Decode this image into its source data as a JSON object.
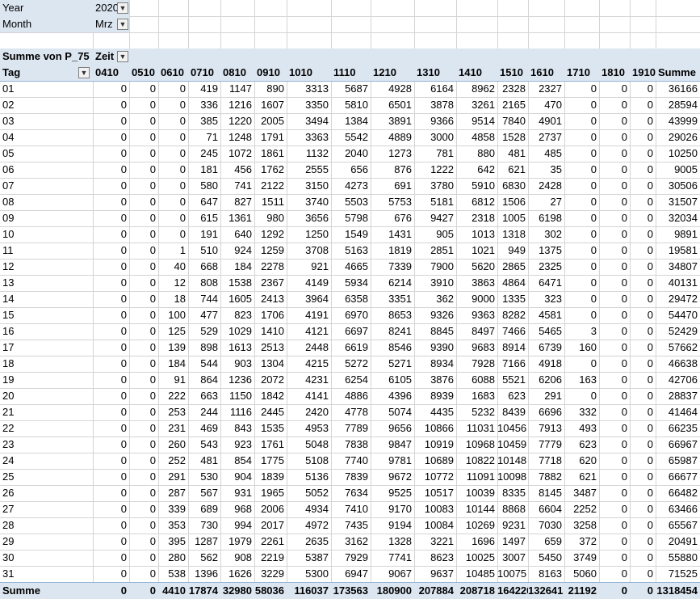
{
  "filters": [
    {
      "label": "Year",
      "value": "2020",
      "icon": "filter-icon"
    },
    {
      "label": "Month",
      "value": "Mrz",
      "icon": "filter-icon"
    }
  ],
  "pivot": {
    "value_label": "Summe von P_75",
    "column_field": "Zeit",
    "row_field": "Tag",
    "column_filter_icon": "filter-icon",
    "row_dropdown_icon": "chevron-down-icon",
    "columns": [
      "0410",
      "0510",
      "0610",
      "0710",
      "0810",
      "0910",
      "1010",
      "1110",
      "1210",
      "1310",
      "1410",
      "1510",
      "1610",
      "1710",
      "1810",
      "1910",
      "Summe"
    ],
    "rows": [
      {
        "tag": "01",
        "values": [
          "0",
          "0",
          "0",
          "419",
          "1147",
          "890",
          "3313",
          "5687",
          "4928",
          "6164",
          "8962",
          "2328",
          "2327",
          "0",
          "0",
          "0",
          "36166"
        ]
      },
      {
        "tag": "02",
        "values": [
          "0",
          "0",
          "0",
          "336",
          "1216",
          "1607",
          "3350",
          "5810",
          "6501",
          "3878",
          "3261",
          "2165",
          "470",
          "0",
          "0",
          "0",
          "28594"
        ]
      },
      {
        "tag": "03",
        "values": [
          "0",
          "0",
          "0",
          "385",
          "1220",
          "2005",
          "3494",
          "1384",
          "3891",
          "9366",
          "9514",
          "7840",
          "4901",
          "0",
          "0",
          "0",
          "43999"
        ]
      },
      {
        "tag": "04",
        "values": [
          "0",
          "0",
          "0",
          "71",
          "1248",
          "1791",
          "3363",
          "5542",
          "4889",
          "3000",
          "4858",
          "1528",
          "2737",
          "0",
          "0",
          "0",
          "29026"
        ]
      },
      {
        "tag": "05",
        "values": [
          "0",
          "0",
          "0",
          "245",
          "1072",
          "1861",
          "1132",
          "2040",
          "1273",
          "781",
          "880",
          "481",
          "485",
          "0",
          "0",
          "0",
          "10250"
        ]
      },
      {
        "tag": "06",
        "values": [
          "0",
          "0",
          "0",
          "181",
          "456",
          "1762",
          "2555",
          "656",
          "876",
          "1222",
          "642",
          "621",
          "35",
          "0",
          "0",
          "0",
          "9005"
        ]
      },
      {
        "tag": "07",
        "values": [
          "0",
          "0",
          "0",
          "580",
          "741",
          "2122",
          "3150",
          "4273",
          "691",
          "3780",
          "5910",
          "6830",
          "2428",
          "0",
          "0",
          "0",
          "30506"
        ]
      },
      {
        "tag": "08",
        "values": [
          "0",
          "0",
          "0",
          "647",
          "827",
          "1511",
          "3740",
          "5503",
          "5753",
          "5181",
          "6812",
          "1506",
          "27",
          "0",
          "0",
          "0",
          "31507"
        ]
      },
      {
        "tag": "09",
        "values": [
          "0",
          "0",
          "0",
          "615",
          "1361",
          "980",
          "3656",
          "5798",
          "676",
          "9427",
          "2318",
          "1005",
          "6198",
          "0",
          "0",
          "0",
          "32034"
        ]
      },
      {
        "tag": "10",
        "values": [
          "0",
          "0",
          "0",
          "191",
          "640",
          "1292",
          "1250",
          "1549",
          "1431",
          "905",
          "1013",
          "1318",
          "302",
          "0",
          "0",
          "0",
          "9891"
        ]
      },
      {
        "tag": "11",
        "values": [
          "0",
          "0",
          "1",
          "510",
          "924",
          "1259",
          "3708",
          "5163",
          "1819",
          "2851",
          "1021",
          "949",
          "1375",
          "0",
          "0",
          "0",
          "19581"
        ]
      },
      {
        "tag": "12",
        "values": [
          "0",
          "0",
          "40",
          "668",
          "184",
          "2278",
          "921",
          "4665",
          "7339",
          "7900",
          "5620",
          "2865",
          "2325",
          "0",
          "0",
          "0",
          "34807"
        ]
      },
      {
        "tag": "13",
        "values": [
          "0",
          "0",
          "12",
          "808",
          "1538",
          "2367",
          "4149",
          "5934",
          "6214",
          "3910",
          "3863",
          "4864",
          "6471",
          "0",
          "0",
          "0",
          "40131"
        ]
      },
      {
        "tag": "14",
        "values": [
          "0",
          "0",
          "18",
          "744",
          "1605",
          "2413",
          "3964",
          "6358",
          "3351",
          "362",
          "9000",
          "1335",
          "323",
          "0",
          "0",
          "0",
          "29472"
        ]
      },
      {
        "tag": "15",
        "values": [
          "0",
          "0",
          "100",
          "477",
          "823",
          "1706",
          "4191",
          "6970",
          "8653",
          "9326",
          "9363",
          "8282",
          "4581",
          "0",
          "0",
          "0",
          "54470"
        ]
      },
      {
        "tag": "16",
        "values": [
          "0",
          "0",
          "125",
          "529",
          "1029",
          "1410",
          "4121",
          "6697",
          "8241",
          "8845",
          "8497",
          "7466",
          "5465",
          "3",
          "0",
          "0",
          "52429"
        ]
      },
      {
        "tag": "17",
        "values": [
          "0",
          "0",
          "139",
          "898",
          "1613",
          "2513",
          "2448",
          "6619",
          "8546",
          "9390",
          "9683",
          "8914",
          "6739",
          "160",
          "0",
          "0",
          "57662"
        ]
      },
      {
        "tag": "18",
        "values": [
          "0",
          "0",
          "184",
          "544",
          "903",
          "1304",
          "4215",
          "5272",
          "5271",
          "8934",
          "7928",
          "7166",
          "4918",
          "0",
          "0",
          "0",
          "46638"
        ]
      },
      {
        "tag": "19",
        "values": [
          "0",
          "0",
          "91",
          "864",
          "1236",
          "2072",
          "4231",
          "6254",
          "6105",
          "3876",
          "6088",
          "5521",
          "6206",
          "163",
          "0",
          "0",
          "42706"
        ]
      },
      {
        "tag": "20",
        "values": [
          "0",
          "0",
          "222",
          "663",
          "1150",
          "1842",
          "4141",
          "4886",
          "4396",
          "8939",
          "1683",
          "623",
          "291",
          "0",
          "0",
          "0",
          "28837"
        ]
      },
      {
        "tag": "21",
        "values": [
          "0",
          "0",
          "253",
          "244",
          "1116",
          "2445",
          "2420",
          "4778",
          "5074",
          "4435",
          "5232",
          "8439",
          "6696",
          "332",
          "0",
          "0",
          "41464"
        ]
      },
      {
        "tag": "22",
        "values": [
          "0",
          "0",
          "231",
          "469",
          "843",
          "1535",
          "4953",
          "7789",
          "9656",
          "10866",
          "11031",
          "10456",
          "7913",
          "493",
          "0",
          "0",
          "66235"
        ]
      },
      {
        "tag": "23",
        "values": [
          "0",
          "0",
          "260",
          "543",
          "923",
          "1761",
          "5048",
          "7838",
          "9847",
          "10919",
          "10968",
          "10459",
          "7779",
          "623",
          "0",
          "0",
          "66967"
        ]
      },
      {
        "tag": "24",
        "values": [
          "0",
          "0",
          "252",
          "481",
          "854",
          "1775",
          "5108",
          "7740",
          "9781",
          "10689",
          "10822",
          "10148",
          "7718",
          "620",
          "0",
          "0",
          "65987"
        ]
      },
      {
        "tag": "25",
        "values": [
          "0",
          "0",
          "291",
          "530",
          "904",
          "1839",
          "5136",
          "7839",
          "9672",
          "10772",
          "11091",
          "10098",
          "7882",
          "621",
          "0",
          "0",
          "66677"
        ]
      },
      {
        "tag": "26",
        "values": [
          "0",
          "0",
          "287",
          "567",
          "931",
          "1965",
          "5052",
          "7634",
          "9525",
          "10517",
          "10039",
          "8335",
          "8145",
          "3487",
          "0",
          "0",
          "66482"
        ]
      },
      {
        "tag": "27",
        "values": [
          "0",
          "0",
          "339",
          "689",
          "968",
          "2006",
          "4934",
          "7410",
          "9170",
          "10083",
          "10144",
          "8868",
          "6604",
          "2252",
          "0",
          "0",
          "63466"
        ]
      },
      {
        "tag": "28",
        "values": [
          "0",
          "0",
          "353",
          "730",
          "994",
          "2017",
          "4972",
          "7435",
          "9194",
          "10084",
          "10269",
          "9231",
          "7030",
          "3258",
          "0",
          "0",
          "65567"
        ]
      },
      {
        "tag": "29",
        "values": [
          "0",
          "0",
          "395",
          "1287",
          "1979",
          "2261",
          "2635",
          "3162",
          "1328",
          "3221",
          "1696",
          "1497",
          "659",
          "372",
          "0",
          "0",
          "20491"
        ]
      },
      {
        "tag": "30",
        "values": [
          "0",
          "0",
          "280",
          "562",
          "908",
          "2219",
          "5387",
          "7929",
          "7741",
          "8623",
          "10025",
          "3007",
          "5450",
          "3749",
          "0",
          "0",
          "55880"
        ]
      },
      {
        "tag": "31",
        "values": [
          "0",
          "0",
          "538",
          "1396",
          "1626",
          "3229",
          "5300",
          "6947",
          "9067",
          "9637",
          "10485",
          "10075",
          "8163",
          "5060",
          "0",
          "0",
          "71525"
        ]
      }
    ],
    "total": {
      "label": "Summe",
      "values": [
        "0",
        "0",
        "4410",
        "17874",
        "32980",
        "58036",
        "116037",
        "173563",
        "180900",
        "207884",
        "208718",
        "164220",
        "132641",
        "21192",
        "0",
        "0",
        "1318454"
      ]
    }
  }
}
